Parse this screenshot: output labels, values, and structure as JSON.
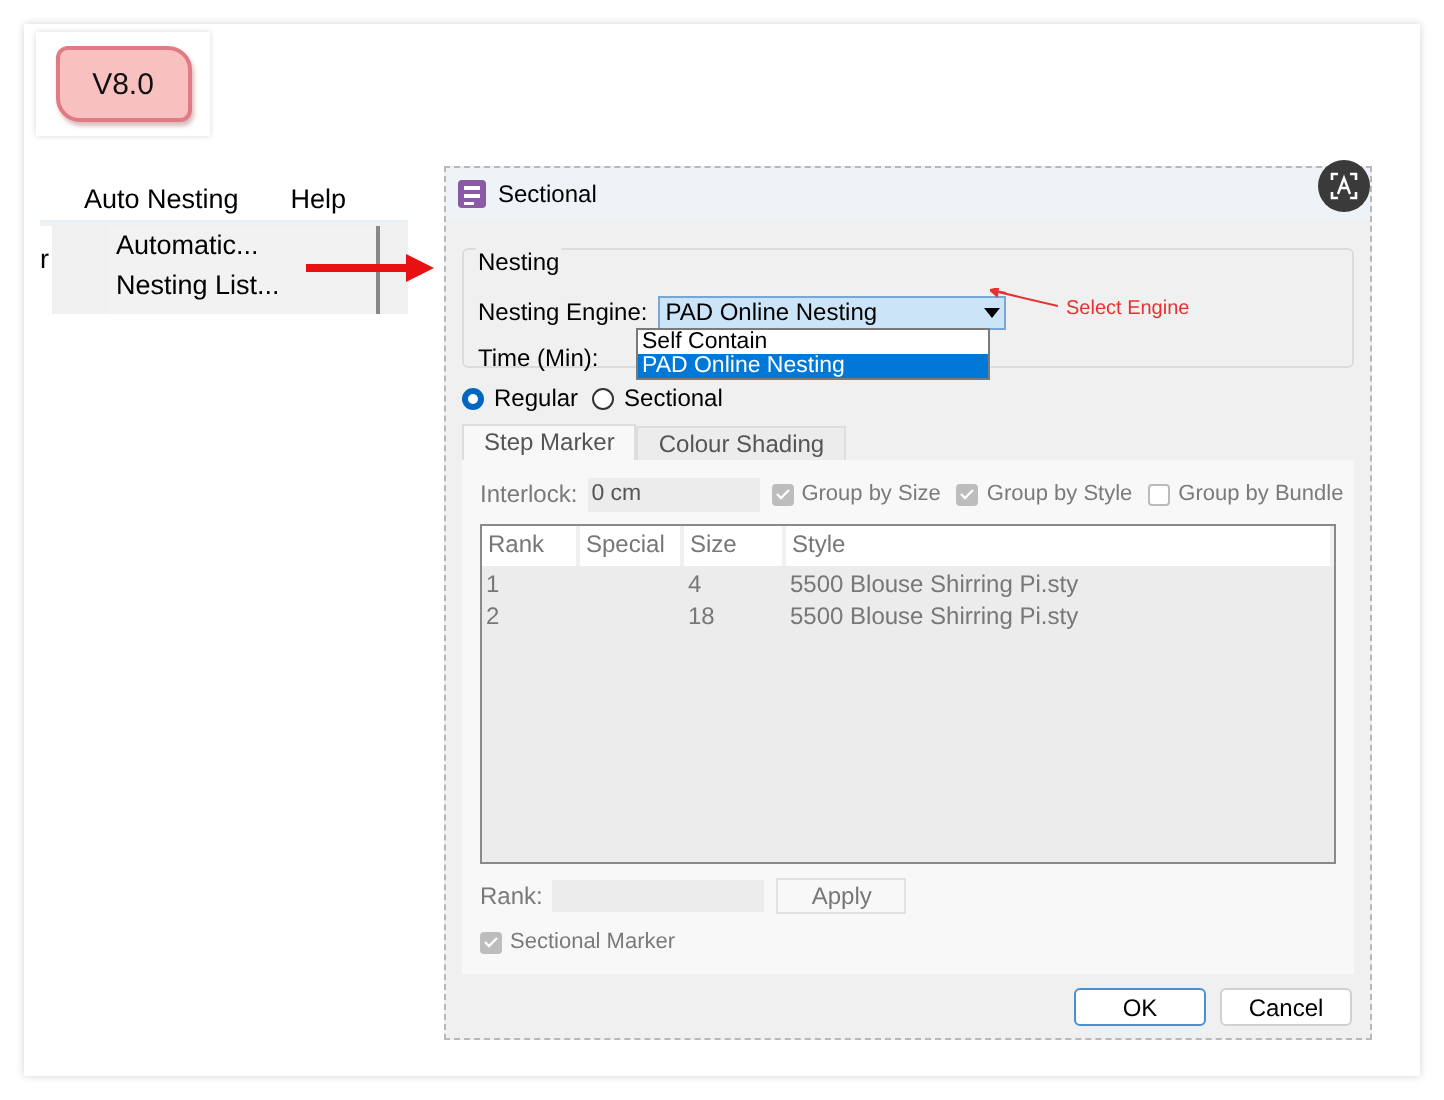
{
  "badge": {
    "text": "V8.0"
  },
  "menu": {
    "side_text": "r",
    "items": [
      {
        "label": "Auto Nesting",
        "selected": false
      },
      {
        "label": "Help",
        "selected": false
      }
    ],
    "dropdown": [
      {
        "label": "Automatic..."
      },
      {
        "label": "Nesting List..."
      }
    ]
  },
  "dialog": {
    "title": "Sectional",
    "nesting": {
      "legend": "Nesting",
      "engine_label": "Nesting Engine:",
      "engine_value": "PAD Online Nesting",
      "expanded": true,
      "options": [
        {
          "label": "Self Contain",
          "selected": false
        },
        {
          "label": "PAD Online Nesting",
          "selected": true
        }
      ],
      "time_label": "Time (Min):"
    },
    "annotation": "Select Engine",
    "modes": [
      {
        "label": "Regular",
        "selected": true
      },
      {
        "label": "Sectional",
        "selected": false
      }
    ],
    "tabs": [
      {
        "label": "Step Marker",
        "selected": true
      },
      {
        "label": "Colour Shading",
        "selected": false
      }
    ],
    "interlock": {
      "label": "Interlock:",
      "value": "0 cm",
      "disabled": true
    },
    "groups": [
      {
        "label": "Group by Size",
        "checked": true,
        "disabled": true
      },
      {
        "label": "Group by Style",
        "checked": true,
        "disabled": true
      },
      {
        "label": "Group by Bundle",
        "checked": false,
        "disabled": true
      }
    ],
    "table": {
      "columns": [
        "Rank",
        "Special",
        "Size",
        "Style"
      ],
      "rows": [
        {
          "rank": "1",
          "size": "4",
          "style": "5500 Blouse Shirring Pi.sty"
        },
        {
          "rank": "2",
          "size": "18",
          "style": "5500 Blouse Shirring Pi.sty"
        }
      ]
    },
    "rank": {
      "label": "Rank:",
      "button": "Apply",
      "disabled": true
    },
    "sectional_marker": {
      "label": "Sectional Marker",
      "checked": true,
      "disabled": true
    },
    "buttons": [
      {
        "label": "OK",
        "kind": "default"
      },
      {
        "label": "Cancel",
        "kind": "normal"
      }
    ]
  }
}
